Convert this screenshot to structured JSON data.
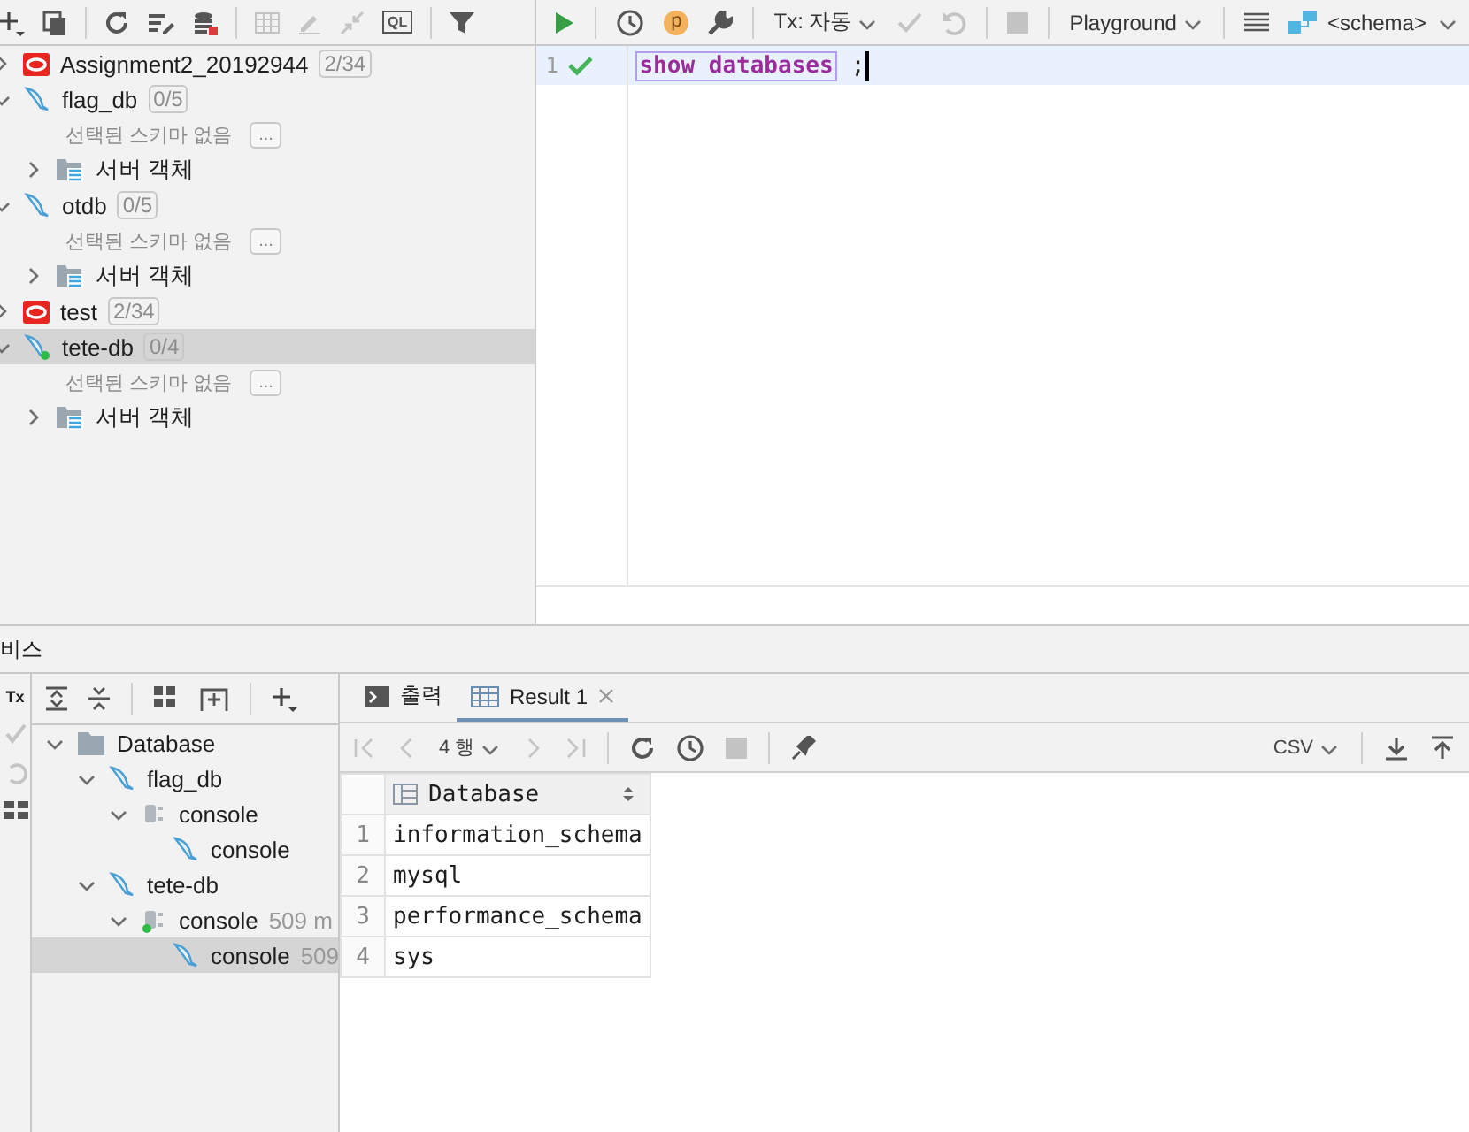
{
  "explorer": {
    "ql_label": "QL",
    "tree": [
      {
        "kind": "oracle",
        "label": "Assignment2_20192944",
        "badge": "2/34",
        "expanded": false,
        "selected": false
      },
      {
        "kind": "mysql",
        "label": "flag_db",
        "badge": "0/5",
        "expanded": true,
        "selected": false,
        "connected": false,
        "children": [
          {
            "kind": "note",
            "label": "선택된 스키마 없음",
            "button": "..."
          },
          {
            "kind": "folder",
            "label": "서버 객체",
            "expanded": false,
            "selected": false
          }
        ]
      },
      {
        "kind": "mysql",
        "label": "otdb",
        "badge": "0/5",
        "expanded": true,
        "selected": false,
        "connected": false,
        "children": [
          {
            "kind": "note",
            "label": "선택된 스키마 없음",
            "button": "..."
          },
          {
            "kind": "folder",
            "label": "서버 객체",
            "expanded": false,
            "selected": false
          }
        ]
      },
      {
        "kind": "oracle",
        "label": "test",
        "badge": "2/34",
        "expanded": false,
        "selected": false
      },
      {
        "kind": "mysql",
        "label": "tete-db",
        "badge": "0/4",
        "expanded": true,
        "selected": true,
        "connected": true,
        "children": [
          {
            "kind": "note",
            "label": "선택된 스키마 없음",
            "button": "..."
          },
          {
            "kind": "folder",
            "label": "서버 객체",
            "expanded": false,
            "selected": false
          }
        ]
      }
    ]
  },
  "editor": {
    "toolbar": {
      "profile": "p",
      "tx": "Tx: 자동",
      "session": "Playground",
      "schema": "<schema>"
    },
    "lines": [
      {
        "number": "1",
        "passed": true,
        "tokens": [
          {
            "kind": "keyword",
            "text": "show databases"
          },
          {
            "kind": "plain",
            "text": ";"
          }
        ]
      }
    ]
  },
  "services": {
    "title": "비스",
    "strip_label": "Tx",
    "tree": [
      {
        "kind": "folder",
        "label": "Database",
        "expanded": true,
        "selected": false,
        "children": [
          {
            "kind": "mysql",
            "label": "flag_db",
            "expanded": true,
            "selected": false,
            "connected": false,
            "children": [
              {
                "kind": "session",
                "label": "console",
                "expanded": true,
                "selected": false,
                "connected": false,
                "children": [
                  {
                    "kind": "mysql",
                    "label": "console",
                    "selected": false,
                    "connected": false
                  }
                ]
              }
            ]
          },
          {
            "kind": "mysql",
            "label": "tete-db",
            "expanded": true,
            "selected": false,
            "connected": false,
            "children": [
              {
                "kind": "session",
                "label": "console",
                "detail": "509 m",
                "expanded": true,
                "selected": false,
                "connected": true,
                "children": [
                  {
                    "kind": "mysql",
                    "label": "console",
                    "detail": "509",
                    "selected": true,
                    "connected": false
                  }
                ]
              }
            ]
          }
        ]
      }
    ]
  },
  "results": {
    "tabs": [
      {
        "kind": "output",
        "label": "출력",
        "selected": false,
        "closable": false
      },
      {
        "kind": "table",
        "label": "Result 1",
        "selected": true,
        "closable": true
      }
    ],
    "pager": "4 행",
    "format": "CSV",
    "table": {
      "columns": [
        "Database"
      ],
      "rows": [
        {
          "number": "1",
          "cells": [
            "information_schema"
          ]
        },
        {
          "number": "2",
          "cells": [
            "mysql"
          ]
        },
        {
          "number": "3",
          "cells": [
            "performance_schema"
          ]
        },
        {
          "number": "4",
          "cells": [
            "sys"
          ]
        }
      ]
    }
  }
}
